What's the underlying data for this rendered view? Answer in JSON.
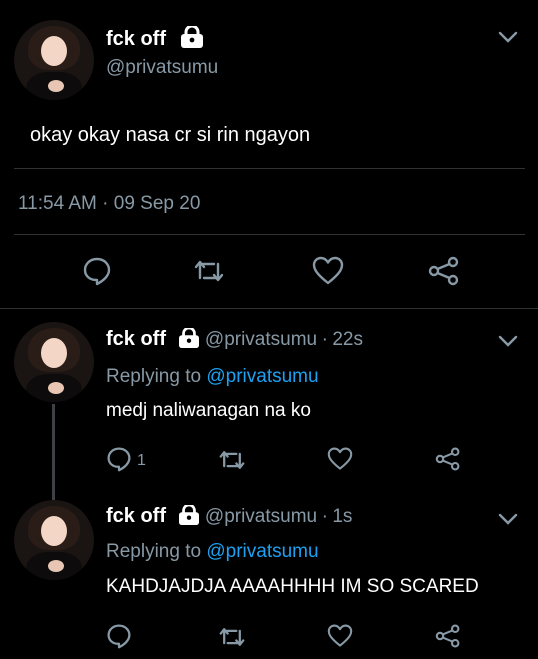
{
  "main_tweet": {
    "display_name": "fck off",
    "handle": "@privatsumu",
    "text": "okay okay nasa cr si rin ngayon",
    "time": "11:54 AM",
    "dot": "·",
    "date": "09 Sep 20"
  },
  "replies": [
    {
      "display_name": "fck off",
      "handle": "@privatsumu",
      "dot": "·",
      "age": "22s",
      "replying_prefix": "Replying to",
      "replying_to": "@privatsumu",
      "text": "medj naliwanagan na ko",
      "reply_count": "1"
    },
    {
      "display_name": "fck off",
      "handle": "@privatsumu",
      "dot": "·",
      "age": "1s",
      "replying_prefix": "Replying to",
      "replying_to": "@privatsumu",
      "text": "KAHDJAJDJA AAAAHHHH IM SO SCARED"
    }
  ],
  "colors": {
    "background": "#000000",
    "secondary_text": "#8899a6",
    "link": "#1da1f2",
    "divider": "#2f3336"
  },
  "icons": [
    "lock-icon",
    "chevron-down-icon",
    "reply-icon",
    "retweet-icon",
    "like-icon",
    "share-icon"
  ]
}
